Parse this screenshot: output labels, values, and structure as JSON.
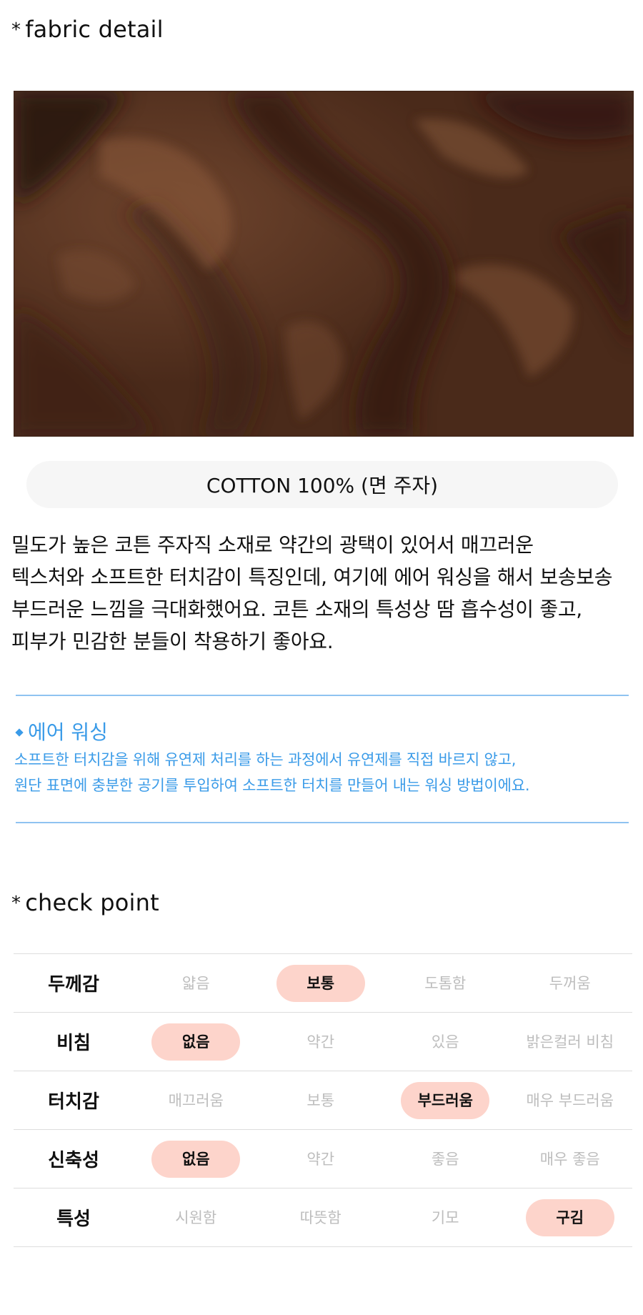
{
  "fabric_section": {
    "title": "fabric detail"
  },
  "fabric_photo": {
    "alt": "brown cotton fabric close-up"
  },
  "material": "COTTON 100% (면 주자)",
  "description_lines": [
    "밀도가 높은 코튼 주자직 소재로 약간의 광택이 있어서 매끄러운",
    "텍스처와 소프트한 터치감이 특징인데, 여기에 에어 워싱을 해서 보송보송",
    "부드러운 느낌을 극대화했어요. 코튼 소재의 특성상 땀 흡수성이 좋고,",
    "피부가 민감한 분들이 착용하기 좋아요."
  ],
  "air_washing": {
    "title": "에어 워싱",
    "lines": [
      "소프트한 터치감을 위해 유연제 처리를 하는 과정에서 유연제를 직접 바르지 않고,",
      "원단 표면에 충분한 공기를 투입하여 소프트한 터치를 만들어 내는 워싱 방법이에요."
    ]
  },
  "check_section": {
    "title": "check point"
  },
  "check_rows": [
    {
      "label": "두께감",
      "options": [
        "얇음",
        "보통",
        "도톰함",
        "두꺼움"
      ],
      "selected": 1
    },
    {
      "label": "비침",
      "options": [
        "없음",
        "약간",
        "있음",
        "밝은컬러 비침"
      ],
      "selected": 0
    },
    {
      "label": "터치감",
      "options": [
        "매끄러움",
        "보통",
        "부드러움",
        "매우 부드러움"
      ],
      "selected": 2
    },
    {
      "label": "신축성",
      "options": [
        "없음",
        "약간",
        "좋음",
        "매우 좋음"
      ],
      "selected": 0
    },
    {
      "label": "특성",
      "options": [
        "시원함",
        "따뜻함",
        "기모",
        "구김"
      ],
      "selected": 3
    }
  ],
  "colors": {
    "accent_blue": "#3a9be8",
    "selected_pill": "#fdd4cb",
    "fabric_brown": "#5a3422"
  }
}
